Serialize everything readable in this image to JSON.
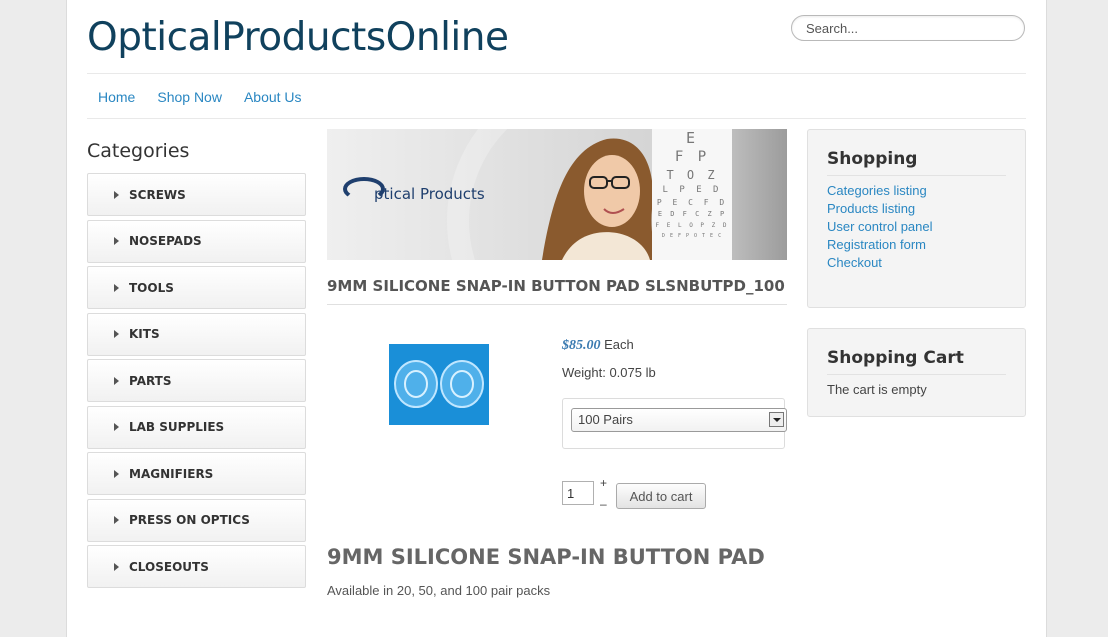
{
  "site": {
    "title": "OpticalProductsOnline"
  },
  "search": {
    "placeholder": "Search..."
  },
  "nav": {
    "items": [
      "Home",
      "Shop Now",
      "About Us"
    ]
  },
  "categories": {
    "title": "Categories",
    "items": [
      "SCREWS",
      "NOSEPADS",
      "TOOLS",
      "KITS",
      "PARTS",
      "LAB SUPPLIES",
      "MAGNIFIERS",
      "PRESS ON OPTICS",
      "CLOSEOUTS"
    ]
  },
  "banner": {
    "logo_text": "ptical Products",
    "eye_chart": [
      "E",
      "F P",
      "T O Z",
      "L P E D",
      "P E C F D",
      "E D F C Z P",
      "F E L O P Z D",
      "D E F P O T E C"
    ]
  },
  "product": {
    "title": "9MM SILICONE SNAP-IN BUTTON PAD SLSNBUTPD_100",
    "price": "$85.00",
    "price_unit": "Each",
    "weight": "Weight: 0.075 lb",
    "option_selected": "100 Pairs",
    "quantity": "1",
    "plus": "+",
    "minus": "–",
    "add_to_cart": "Add to cart",
    "heading": "9MM SILICONE SNAP-IN BUTTON PAD",
    "description": "Available in 20, 50, and 100 pair packs"
  },
  "shopping": {
    "title": "Shopping",
    "links": [
      "Categories listing",
      "Products listing",
      "User control panel",
      "Registration form",
      "Checkout"
    ]
  },
  "cart": {
    "title": "Shopping Cart",
    "status": "The cart is empty"
  }
}
